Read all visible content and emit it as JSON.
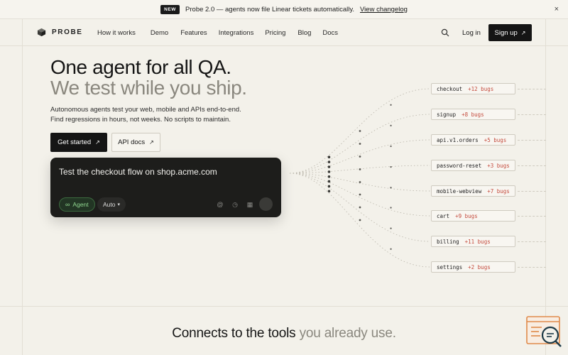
{
  "announcement": {
    "badge": "NEW",
    "text": "Probe 2.0 — agents now file Linear tickets automatically.",
    "link": "View changelog",
    "close": "×"
  },
  "nav": {
    "brand": "PROBE",
    "links": [
      "How it works",
      "Demo",
      "Features",
      "Integrations",
      "Pricing",
      "Blog",
      "Docs"
    ],
    "login": "Log in",
    "signup": "Sign up",
    "signup_arrow": "↗"
  },
  "hero": {
    "title": "One agent for all QA.",
    "subtitle": "We test while you ship.",
    "description_line1": "Autonomous agents test your web, mobile and APIs end-to-end.",
    "description_line2": "Find regressions in hours, not weeks. No scripts to maintain.",
    "cta_primary": "Get started",
    "cta_secondary": "API docs",
    "arrow": "↗"
  },
  "prompt": {
    "text": "Test the checkout flow on shop.acme.com",
    "agent_label": "Agent",
    "agent_icon": "∞",
    "mode_label": "Auto",
    "mode_chevron": "▾",
    "tool_mention": "@",
    "tool_clock": "◷",
    "tool_square": "▦"
  },
  "findings": [
    {
      "name": "checkout",
      "bugs": "+12 bugs"
    },
    {
      "name": "signup",
      "bugs": "+8 bugs"
    },
    {
      "name": "api.v1.orders",
      "bugs": "+5 bugs"
    },
    {
      "name": "password-reset",
      "bugs": "+3 bugs"
    },
    {
      "name": "mobile-webview",
      "bugs": "+7 bugs"
    },
    {
      "name": "cart",
      "bugs": "+9 bugs"
    },
    {
      "name": "billing",
      "bugs": "+11 bugs"
    },
    {
      "name": "settings",
      "bugs": "+2 bugs"
    }
  ],
  "bottom": {
    "title_main": "Connects to the tools",
    "title_muted": "you already use."
  },
  "colors": {
    "background": "#f3f1ea",
    "dark": "#151515",
    "muted_text": "#8a877e",
    "bug_red": "#c44a3c",
    "agent_green": "#8fd68f"
  }
}
